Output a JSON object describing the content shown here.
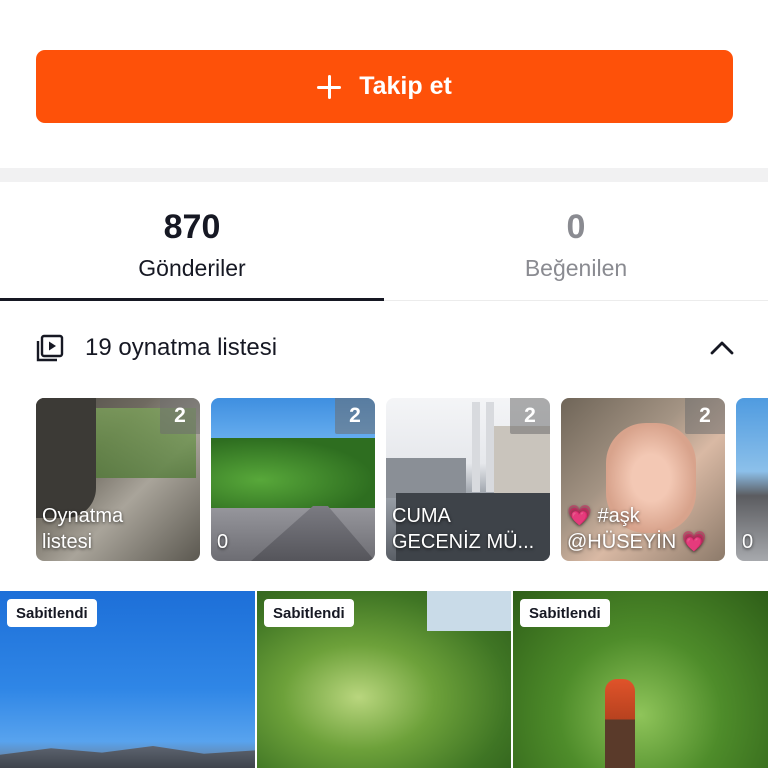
{
  "follow_button": {
    "label": "Takip et"
  },
  "tabs": [
    {
      "count": "870",
      "label": "Gönderiler"
    },
    {
      "count": "0",
      "label": "Beğenilen"
    }
  ],
  "playlists": {
    "title": "19 oynatma listesi",
    "items": [
      {
        "name": "Oynatma\nlistesi",
        "count": "2"
      },
      {
        "name": "0",
        "count": "2"
      },
      {
        "name": "CUMA\nGECENİZ MÜ...",
        "count": "2"
      },
      {
        "name": "💗 #aşk\n@HÜSEYİN 💗",
        "count": "2"
      },
      {
        "name": "0",
        "count": ""
      }
    ]
  },
  "videos": {
    "pinned_label": "Sabitlendi",
    "items": [
      {
        "pinned": true
      },
      {
        "pinned": true
      },
      {
        "pinned": true
      }
    ]
  },
  "colors": {
    "accent": "#fe5109",
    "text_primary": "#161823",
    "text_secondary": "#8a8b91"
  }
}
